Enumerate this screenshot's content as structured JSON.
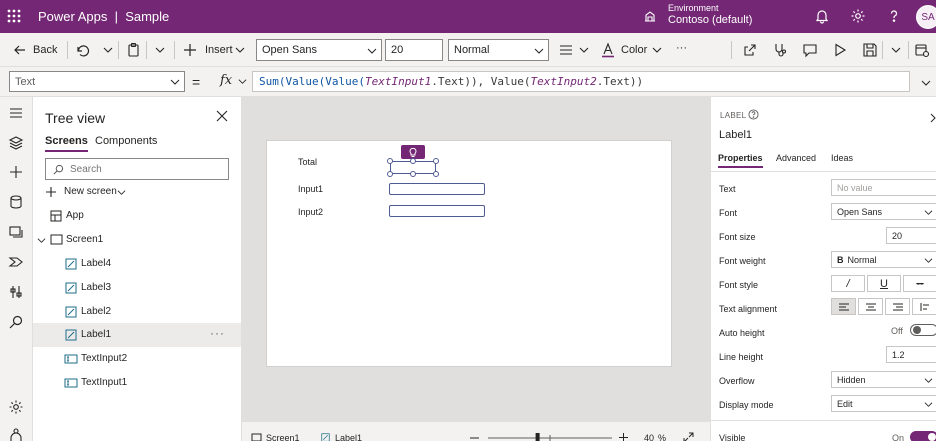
{
  "colors": {
    "brand": "#742774",
    "chrome": "#f3f2f1",
    "canvas_bg": "#e1dfdd",
    "control_border": "#4f5b93"
  },
  "titlebar": {
    "app_title": "Power Apps  |  Sample",
    "environment_label": "Environment",
    "environment_value": "Contoso (default)",
    "avatar_initials": "SA",
    "icons": [
      "waffle-icon",
      "environment-icon",
      "bell-icon",
      "gear-icon",
      "help-icon"
    ]
  },
  "command_bar": {
    "back_label": "Back",
    "insert_label": "Insert",
    "font_family": "Open Sans",
    "font_size": "20",
    "font_weight": "Normal",
    "color_label": "Color",
    "more_label": "···"
  },
  "formula_bar": {
    "property": "Text",
    "equals": "=",
    "fx": "fx",
    "formula_parts": {
      "p1": "Sum(Value(Value(",
      "p2": "TextInput1",
      "p3": ".Text)), Value(",
      "p4": "TextInput2",
      "p5": ".Text))"
    }
  },
  "tree": {
    "title": "Tree view",
    "tabs": {
      "screens": "Screens",
      "components": "Components"
    },
    "search_placeholder": "Search",
    "new_screen": "New screen",
    "app": "App",
    "screen": "Screen1",
    "children": [
      "Label4",
      "Label3",
      "Label2",
      "Label1",
      "TextInput2",
      "TextInput1"
    ],
    "more": "···"
  },
  "canvas": {
    "labels": {
      "total": "Total",
      "input1": "Input1",
      "input2": "Input2"
    }
  },
  "statusbar": {
    "screen": "Screen1",
    "selected": "Label1",
    "zoom": "40",
    "zoom_unit": "%",
    "zoom_level": 0.4
  },
  "properties": {
    "control_type": "LABEL",
    "control_name": "Label1",
    "tabs": {
      "properties": "Properties",
      "advanced": "Advanced",
      "ideas": "Ideas"
    },
    "rows": {
      "text": {
        "label": "Text",
        "value": "No value"
      },
      "font": {
        "label": "Font",
        "value": "Open Sans"
      },
      "font_size": {
        "label": "Font size",
        "value": "20"
      },
      "font_weight": {
        "label": "Font weight",
        "value": "Normal",
        "glyph": "B"
      },
      "font_style": {
        "label": "Font style",
        "italic": "/",
        "underline": "U",
        "strike": "--"
      },
      "text_alignment": {
        "label": "Text alignment"
      },
      "auto_height": {
        "label": "Auto height",
        "value": "Off"
      },
      "line_height": {
        "label": "Line height",
        "value": "1.2"
      },
      "overflow": {
        "label": "Overflow",
        "value": "Hidden"
      },
      "display_mode": {
        "label": "Display mode",
        "value": "Edit"
      },
      "visible": {
        "label": "Visible",
        "value": "On"
      }
    }
  }
}
